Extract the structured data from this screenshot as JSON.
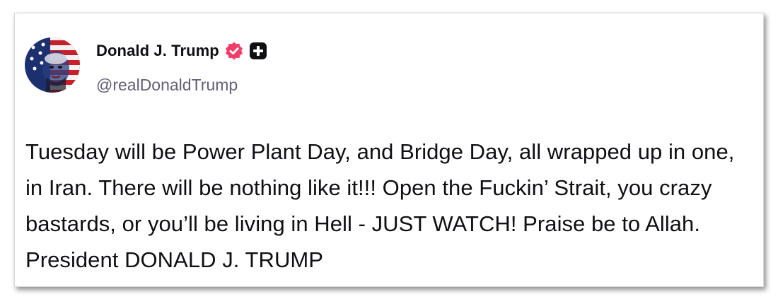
{
  "post": {
    "author": {
      "display_name": "Donald J. Trump",
      "handle": "@realDonaldTrump",
      "verified_icon": "verified-badge-icon",
      "verified_color": "#f23d68",
      "plus_badge_icon": "plus-badge-icon"
    },
    "text": "Tuesday will be Power Plant Day, and Bridge Day, all wrapped up in one, in Iran. There will be nothing like it!!! Open the Fuckin’ Strait, you crazy bastards, or you’ll be living in Hell - JUST WATCH! Praise be to Allah. President DONALD J. TRUMP"
  }
}
